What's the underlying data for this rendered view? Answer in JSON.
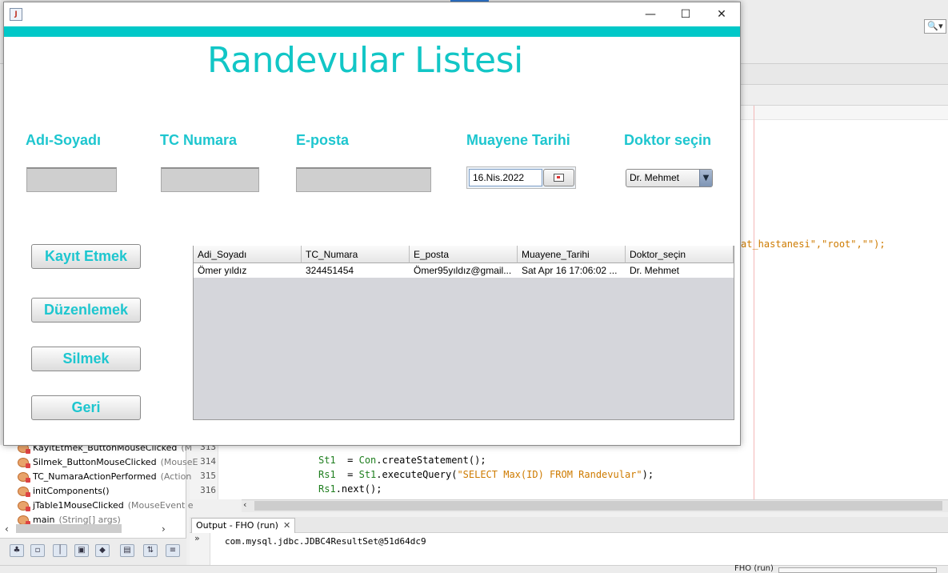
{
  "window": {
    "icon_label": "J",
    "controls": {
      "minimize": "—",
      "maximize": "☐",
      "close": "✕"
    }
  },
  "form": {
    "title": "Randevular Listesi",
    "labels": {
      "name": "Adı-Soyadı",
      "tc": "TC Numara",
      "email": "E-posta",
      "date": "Muayene Tarihi",
      "doctor": "Doktor seçin"
    },
    "inputs": {
      "name": "",
      "tc": "",
      "email": ""
    },
    "date_value": "16.Nis.2022",
    "doctor_selected": "Dr. Mehmet",
    "buttons": {
      "save": "Kayıt Etmek",
      "edit": "Düzenlemek",
      "delete": "Silmek",
      "back": "Geri"
    }
  },
  "table": {
    "columns": [
      "Adi_Soyadı",
      "TC_Numara",
      "E_posta",
      "Muayene_Tarihi",
      "Doktor_seçin"
    ],
    "rows": [
      [
        "Ömer yıldız",
        "324451454",
        "Ömer95yıldız@gmail...",
        "Sat Apr 16 17:06:02 ...",
        "Dr. Mehmet"
      ]
    ]
  },
  "ide": {
    "code_fragment_top": "at_hastanesi\",\"root\",\"\");",
    "lines": [
      {
        "num": "313",
        "text": ""
      },
      {
        "num": "314",
        "var": "St1",
        "op": "  = ",
        "obj": "Con",
        "rest": ".createStatement();"
      },
      {
        "num": "315",
        "var": "Rs1",
        "op": "  = ",
        "obj": "St1",
        "rest": ".executeQuery(",
        "str": "\"SELECT Max(ID) FROM Randevular\"",
        "tail": ");"
      },
      {
        "num": "316",
        "var": "Rs1",
        "op": "",
        "obj": "",
        "rest": ".next();"
      }
    ],
    "navigator": [
      {
        "name": "KayıtEtmek_ButtonMouseClicked",
        "param": "(M"
      },
      {
        "name": "Silmek_ButtonMouseClicked",
        "param": "(MouseE"
      },
      {
        "name": "TC_NumaraActionPerformed",
        "param": "(Action"
      },
      {
        "name": "initComponents()",
        "param": ""
      },
      {
        "name": "jTable1MouseClicked",
        "param": "(MouseEvent e"
      },
      {
        "name": "main",
        "param": "(String[] args)"
      }
    ],
    "output_tab": "Output - FHO (run)",
    "output_prompt": "»",
    "output_line": "com.mysql.jdbc.JDBC4ResultSet@51d64dc9",
    "status_project": "FHO (run)",
    "search_icon": "search-icon"
  },
  "colors": {
    "teal_band": "#00c8c8",
    "title": "#12c6c6",
    "label": "#1ec6cf"
  }
}
